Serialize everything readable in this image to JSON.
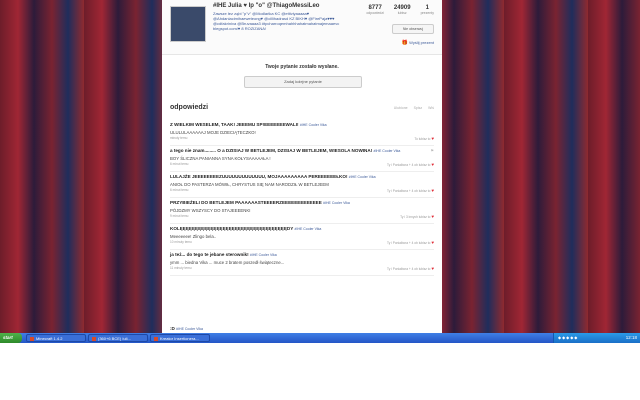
{
  "profile": {
    "name": "#IHE Julia ♥ Ip \"o\" @ThiagoMessiLeo",
    "bio": "Zawsze łez ząbi \"p\"v\" @Modlańka KC @ettiviyaaaaa♥ @Ahdaniacimihaeweteong♥ @cillihadrasd KZ BIKH♥ @FirePaja♥♥♥ @cdfakriniva @Bruvaaaa3 #tpcharroqemhahhhahatmahatmajemaaevc blegspot.com/♥ 8 ROZIZANA!",
    "stats": [
      {
        "num": "8777",
        "label": "odpowiedzi"
      },
      {
        "num": "24909",
        "label": "lubisz"
      },
      {
        "num": "1",
        "label": "prezenty"
      }
    ],
    "observe_label": "Nie obserwuj",
    "gift_label": "Wyślij prezent"
  },
  "sent_message": "Twoje pytanie zostało wysłane.",
  "ask_another_label": "Zadaj kolejne pytanie",
  "section": {
    "title": "odpowiedzi",
    "filters": [
      "Ulubione",
      "Spisz",
      "Wiś"
    ]
  },
  "answers": [
    {
      "question": "Z WIELKIM WESELEM, TAAK! JEEEMU SP!EEEEEEEWALI!",
      "from": "#IHE Cooler Vika",
      "answer": "ULULULAAAAAAJ MOJE DZIECIĄTECZKO!",
      "time": "minuty temu",
      "likes": "To lubisz to"
    },
    {
      "question": "a tego nie znam......... O a DZISIAJ W BETLEJEM, DZISIAJ W BETLEJEM, WIESOLA NOWINA!",
      "from": "#IHE Cooler Vika",
      "answer": "BOY ŚLICZNA PANIANNA SYNA KOŁYSAAAAAŁA !",
      "time": "6 minut temu",
      "likes": "Ty i Poniaibora + 4 ob lubisz to"
    },
    {
      "question": "LULAJŻE JEEEEEEEEZUUUUUUUUUUUUU, MOJAAAAAAAAA PEREEEEEEŁKO!",
      "from": "#IHE Cooler Vika",
      "answer": "ANIOŁ DO PASTERZA MÓWIŁ, CHRYSTUS SIĘ NAM NARODZIŁ W BETLEJEEM",
      "time": "6 minut temu",
      "likes": "Ty i Poniaibora + 4 ob lubisz to"
    },
    {
      "question": "PRZYBIEŻELI DO BETLEJEM PAAAAAASTEEEERZEEEEEEEEEEEEE",
      "from": "#IHE Cooler Vika",
      "answer": "PÓJDZMY WSZYSCY DO STAJEEEENKI",
      "time": "9 minut temu",
      "likes": "Ty i 3 innych lubisz to"
    },
    {
      "question": "KOLĘĘĘĘĘĘĘĘĘĘĘĘĘĘĘĘĘĘĘĘĘĘĘĘĘĘĘĘĘĘĘĘĘĘĘDY",
      "from": "#IHE Cooler Vika",
      "answer": "Meeeeeee! Zlingo bela..",
      "time": "10 minuty temu",
      "likes": "Ty i Poniaibora + 4 ob lubisz to"
    },
    {
      "question": "ja też... do tego te jebane sterownik!",
      "from": "#IHE Cooler Vika",
      "answer": "ymm ... biedna Vika ... muce 2 bratem poszedł świąteczne...",
      "time": "11 minuty temu",
      "likes": "Ty i Poniaibora + 4 ob lubisz to"
    }
  ],
  "partial_question": {
    "question": ":D",
    "from": "#IHE Cooler Vika"
  },
  "taskbar": {
    "start_label": "start",
    "tasks": [
      "Minecraft 1.4.2",
      "(360+6 BCE) Iuli...",
      "Kreator Insertionera..."
    ],
    "clock": "12:18"
  }
}
